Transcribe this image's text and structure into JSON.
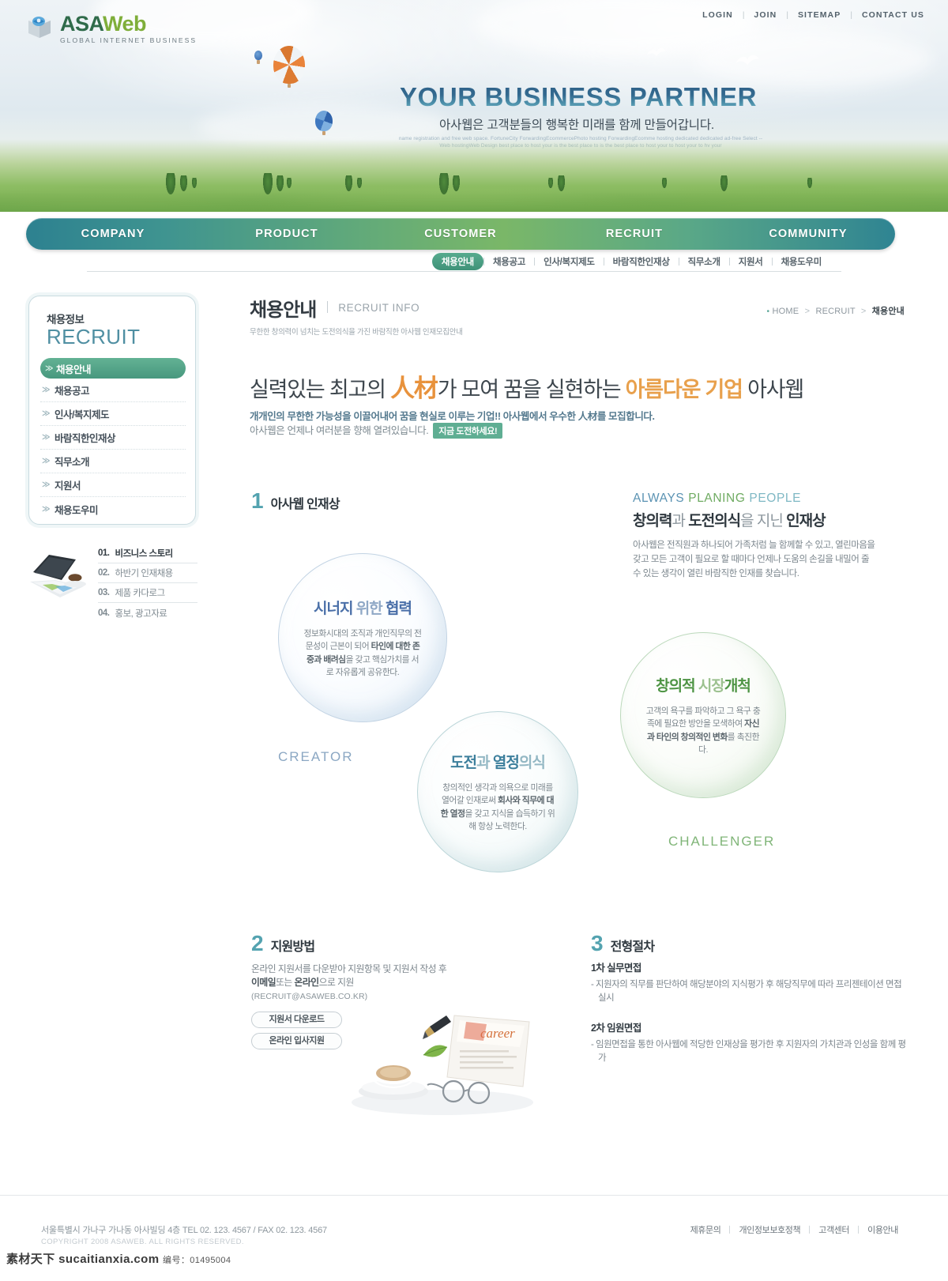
{
  "brand": {
    "logo_main_a": "ASA",
    "logo_main_w": "Web",
    "tagline": "GLOBAL INTERNET BUSINESS"
  },
  "topnav": [
    {
      "label": "LOGIN"
    },
    {
      "label": "JOIN"
    },
    {
      "label": "SITEMAP"
    },
    {
      "label": "CONTACT US"
    }
  ],
  "hero": {
    "title": "YOUR BUSINESS PARTNER",
    "subtitle": "아사웹은 고객분들의 행복한 미래를 함께 만들어갑니다.",
    "fineprint": "name registration and free web space. FortuneCity ForwardingEcommercePhoto hosting ForwardingEcomme hosting dedicated dedicated ad-free Select --Web hostingWeb Design best place to host your is the best place to is the best place to host your to host your to hv your"
  },
  "mainnav": [
    {
      "label": "COMPANY"
    },
    {
      "label": "PRODUCT"
    },
    {
      "label": "CUSTOMER"
    },
    {
      "label": "RECRUIT"
    },
    {
      "label": "COMMUNITY"
    }
  ],
  "subnav": {
    "active": "채용안내",
    "items": [
      {
        "label": "채용안내",
        "active": true
      },
      {
        "label": "채용공고",
        "active": false
      },
      {
        "label": "인사/복지제도",
        "active": false
      },
      {
        "label": "바람직한인재상",
        "active": false
      },
      {
        "label": "직무소개",
        "active": false
      },
      {
        "label": "지원서",
        "active": false
      },
      {
        "label": "채용도우미",
        "active": false
      }
    ]
  },
  "page": {
    "title": "채용안내",
    "title_en": "RECRUIT INFO",
    "description": "무한한 창의력이 넘치는 도전의식을 가진 바람직한 아사웹 인재모집안내"
  },
  "breadcrumb": {
    "home": "HOME",
    "section": "RECRUIT",
    "current": "채용안내"
  },
  "headline": {
    "part1": "실력있는 최고의 ",
    "hanja": "人材",
    "part2": "가 모여 꿈을 실현하는 ",
    "orange": "아름다운 기업",
    "part3": " 아사웹",
    "lead1": "개개인의 무한한 가능성을 이끌어내어 꿈을 현실로 이루는 기업!!  아사웹에서 우수한 人材를 모집합니다.",
    "lead2": "아사웹은 언제나 여러분을 향해 열려있습니다.",
    "badge": "지금 도전하세요!"
  },
  "sidebar": {
    "heading_ko": "채용정보",
    "heading_en": "RECRUIT",
    "arrow": "≫",
    "items": [
      {
        "label": "채용안내",
        "active": true
      },
      {
        "label": "채용공고",
        "active": false
      },
      {
        "label": "인사/복지제도",
        "active": false
      },
      {
        "label": "바람직한인재상",
        "active": false
      },
      {
        "label": "직무소개",
        "active": false
      },
      {
        "label": "지원서",
        "active": false
      },
      {
        "label": "채용도우미",
        "active": false
      }
    ],
    "promo": [
      {
        "num": "01.",
        "label": "비즈니스 스토리"
      },
      {
        "num": "02.",
        "label": "하반기 인재채용"
      },
      {
        "num": "03.",
        "label": "제품 카다로그"
      },
      {
        "num": "04.",
        "label": "홍보, 광고자료"
      }
    ]
  },
  "section1": {
    "num": "1",
    "label": "아사웹 인재상",
    "intro_eng_1": "ALWAYS",
    "intro_eng_2": "PLANING",
    "intro_eng_3": "PEOPLE",
    "intro_head_strong": "창의력",
    "intro_head_mid": "과 ",
    "intro_head_strong2": "도전의식",
    "intro_head_light": "을 지닌 ",
    "intro_head_strong3": "인재상",
    "intro_para": "아사웹은 전직원과 하나되어 가족처럼 늘 함께할 수 있고, 열린마음을 갖고 모든 고객이 필요로 할 때마다 언제나 도움의 손길을 내밀어 줄 수 있는 생각이 열린 바람직한 인재를 찾습니다.",
    "circles": [
      {
        "title_dark": "시너지",
        "title_light": " 위한 ",
        "title_dark2": "협력",
        "body_1": "정보화시대의 조직과 개인직무의 전문성이 근본이 되어 ",
        "body_bold": "타인에 대한 존중과 배려심",
        "body_2": "을 갖고 핵심가치를 서로 자유롭게 공유한다."
      },
      {
        "title_dark": "도전",
        "title_light": "과 ",
        "title_dark2": "열정",
        "title_light2": "의식",
        "body_1": "창의적인 생각과 의욕으로 미래를 열어갈 인재로써 ",
        "body_bold": "회사와 직무에 대한 열정",
        "body_2": "을 갖고 지식을 습득하기 위해 항상 노력한다."
      },
      {
        "title_dark": "창의적",
        "title_light": " 시장",
        "title_dark2": "개척",
        "body_1": "고객의 욕구를 파악하고 그 욕구 충족에 필요한 방안을 모색하여 ",
        "body_bold": "자신과 타인의 창의적인 변화",
        "body_2": "를 촉진한다."
      }
    ],
    "caption_creator": "CREATOR",
    "caption_challenger": "CHALLENGER"
  },
  "section2": {
    "num": "2",
    "label": "지원방법",
    "line1": "온라인 지원서를 다운받아 지원항목 및 지원서 작성 후",
    "line2_bold_a": "이메일",
    "line2_mid": "또는 ",
    "line2_bold_b": "온라인",
    "line2_end": "으로 지원",
    "email": "(RECRUIT@ASAWEB.CO.KR)",
    "buttons": [
      {
        "label": "지원서 다운로드"
      },
      {
        "label": "온라인 입사지원"
      }
    ]
  },
  "section3": {
    "num": "3",
    "label": "전형절차",
    "steps": [
      {
        "title": "1차 실무면접",
        "text": "- 지원자의 직무를 판단하여 해당분야의 지식평가 후 해당직무에 따라 프리젠테이션 면접 실시"
      },
      {
        "title": "2차 임원면접",
        "text": "- 임원면접을 통한 아사웹에 적당한 인재상을 평가한 후 지원자의 가치관과 인성을 함께 평가"
      }
    ]
  },
  "footer": {
    "address": "서울특별시 가나구 가나동 아사빌딩 4층  TEL 02. 123. 4567 / FAX 02. 123. 4567",
    "copyright": "COPYRIGHT 2008 ASAWEB. ALL RIGHTS RESERVED.",
    "links": [
      {
        "label": "제휴문의"
      },
      {
        "label": "개인정보보호정책"
      },
      {
        "label": "고객센터"
      },
      {
        "label": "이용안내"
      }
    ]
  },
  "watermark": {
    "site": "素材天下 sucaitianxia.com",
    "code": "编号：01495004"
  },
  "colors": {
    "nav_teal": "#2d8190",
    "nav_green": "#7ab768",
    "accent_orange": "#e8a04c",
    "accent_teal": "#54a3b0",
    "active_green": "#47987e"
  }
}
